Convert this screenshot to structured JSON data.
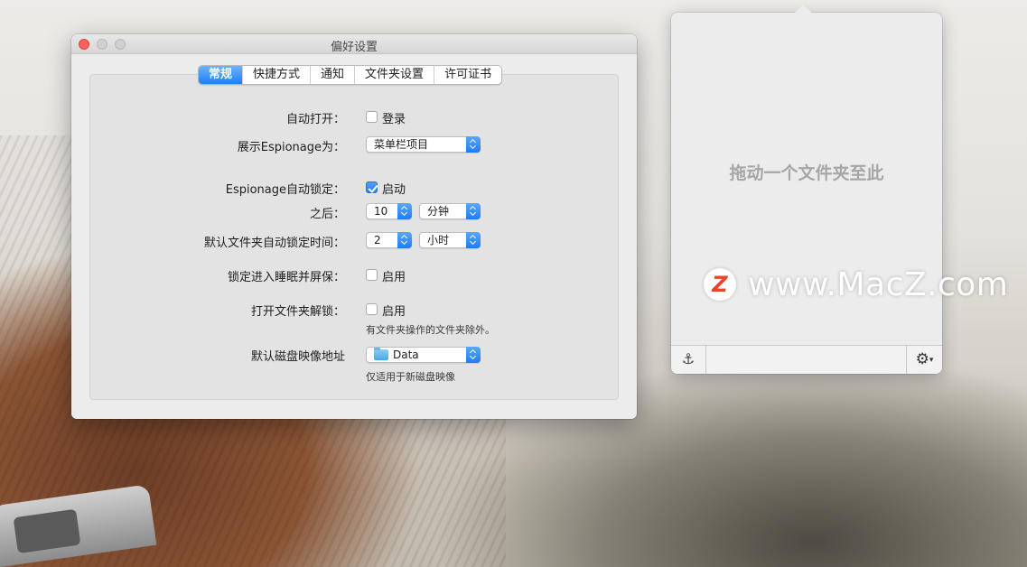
{
  "window": {
    "title": "偏好设置"
  },
  "tabs": [
    {
      "label": "常规",
      "active": true
    },
    {
      "label": "快捷方式",
      "active": false
    },
    {
      "label": "通知",
      "active": false
    },
    {
      "label": "文件夹设置",
      "active": false
    },
    {
      "label": "许可证书",
      "active": false
    }
  ],
  "general": {
    "auto_open": {
      "label": "自动打开：",
      "checkbox_label": "登录",
      "checked": false
    },
    "show_as": {
      "label": "展示Espionage为：",
      "value": "菜单栏项目"
    },
    "auto_lock": {
      "label": "Espionage自动锁定：",
      "checkbox_label": "启动",
      "checked": true
    },
    "after": {
      "label": "之后：",
      "amount": "10",
      "unit": "分钟"
    },
    "default_lock_time": {
      "label": "默认文件夹自动锁定时间：",
      "amount": "2",
      "unit": "小时"
    },
    "lock_sleep": {
      "label": "锁定进入睡眠并屏保：",
      "checkbox_label": "启用",
      "checked": false
    },
    "unlock_on_open": {
      "label": "打开文件夹解锁：",
      "checkbox_label": "启用",
      "checked": false,
      "hint": "有文件夹操作的文件夹除外。"
    },
    "disk_image": {
      "label": "默认磁盘映像地址",
      "value": "Data",
      "hint": "仅适用于新磁盘映像"
    }
  },
  "popover": {
    "drop_text": "拖动一个文件夹至此",
    "anchor_icon": "anchor-icon",
    "gear_icon": "gear-icon"
  },
  "watermark": {
    "logo": "Z",
    "text": "www.MacZ.com"
  },
  "colors": {
    "accent": "#1c7ef5",
    "close": "#fc605c"
  }
}
